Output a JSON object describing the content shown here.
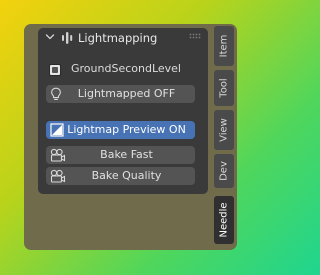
{
  "panel": {
    "title": "Lightmapping",
    "collapse_icon": "chevron-down-icon",
    "header_icon": "lightmap-icon",
    "drag_icon": "drag-grip-icon"
  },
  "object_toggle": {
    "label": "GroundSecondLevel",
    "checked": false
  },
  "buttons": {
    "lightmapped": {
      "label": "Lightmapped OFF",
      "icon": "lightbulb-icon"
    },
    "preview": {
      "label": "Lightmap Preview ON",
      "icon": "image-preview-icon",
      "active": true
    },
    "bake_fast": {
      "label": "Bake Fast",
      "icon": "camera-icon"
    },
    "bake_quality": {
      "label": "Bake Quality",
      "icon": "camera-icon"
    }
  },
  "side_tabs": [
    {
      "label": "Item"
    },
    {
      "label": "Tool"
    },
    {
      "label": "View"
    },
    {
      "label": "Dev"
    },
    {
      "label": "Needle",
      "selected": true
    }
  ],
  "colors": {
    "active_button": "#4772b3",
    "panel_bg": "#3a3a3a",
    "frame_bg": "#6f6b4b"
  }
}
